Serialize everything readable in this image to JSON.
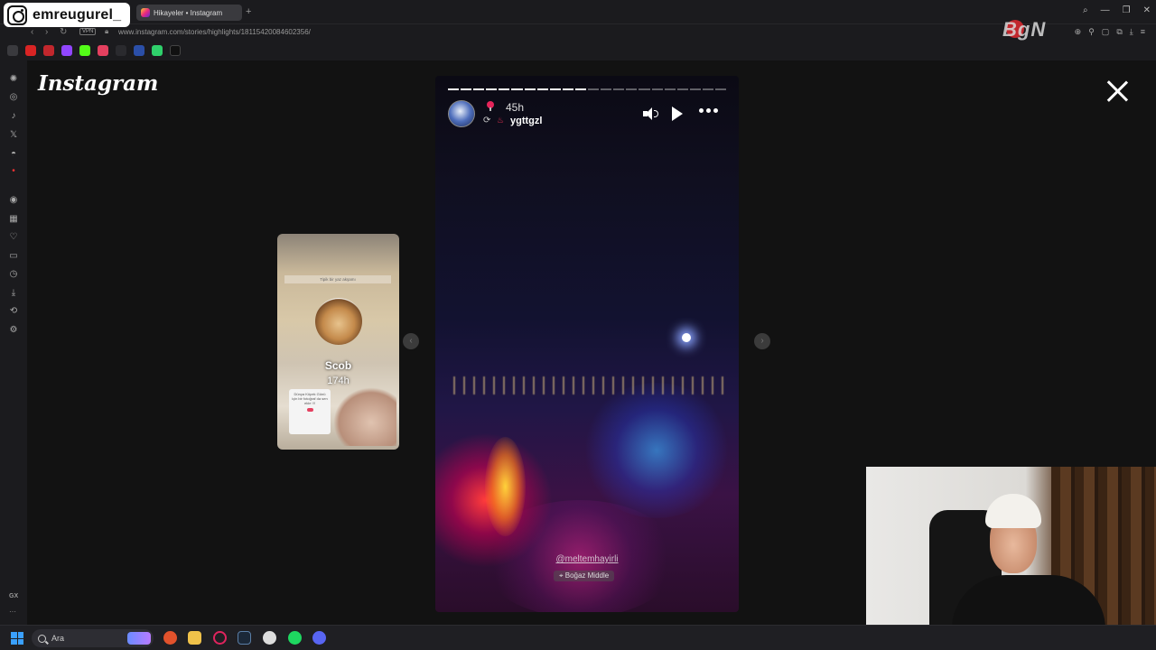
{
  "streamer": {
    "name": "emreugurel_"
  },
  "browser": {
    "tab_title": "Hikayeler • Instagram",
    "new_tab": "+",
    "url": "www.instagram.com/stories/highlights/18115420084602356/",
    "vpn_label": "VPN",
    "watermark": "BgN"
  },
  "page": {
    "logo_text": "Instagram"
  },
  "preview": {
    "name": "Scob",
    "time": "174h",
    "sticker_text": "Tipik bir yaz akşamı",
    "card_text": "Dünya Köpek Günü için bir fotoğraf da sen ekle !!!"
  },
  "story": {
    "time": "45h",
    "user": "ygttgzl",
    "mention": "@meltemhayirli",
    "location": "Boğaz Middle",
    "progress_total": 22,
    "progress_done": 11
  },
  "taskbar": {
    "search_placeholder": "Ara"
  },
  "colors": {
    "accent": "#e4405f",
    "background": "#121212",
    "chrome": "#1b1b1e"
  }
}
